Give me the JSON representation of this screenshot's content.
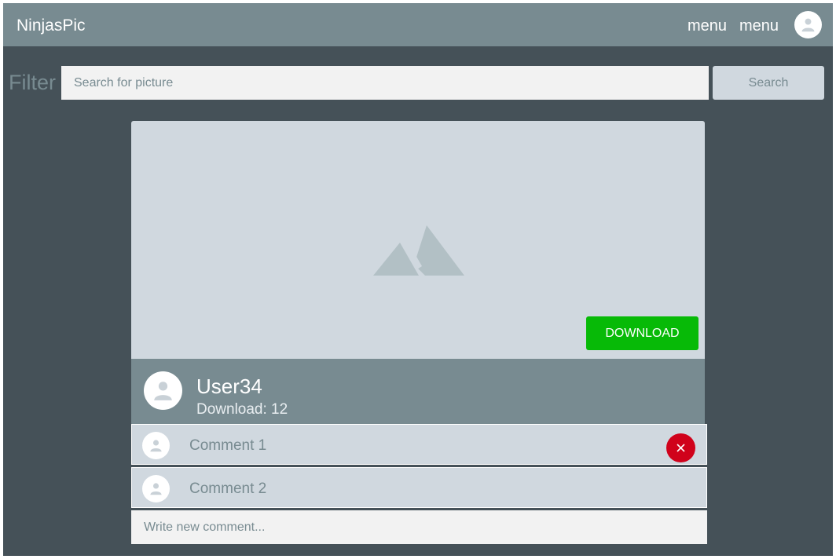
{
  "header": {
    "brand": "NinjasPic",
    "menus": [
      "menu",
      "menu"
    ],
    "avatar_icon": "user-icon"
  },
  "filter": {
    "label": "Filter",
    "placeholder": "Search for picture",
    "value": "",
    "button_label": "Search"
  },
  "picture": {
    "image_icon": "image-placeholder-icon",
    "download_label": "DOWNLOAD",
    "owner_name": "User34",
    "downloads_text": "Download: 12"
  },
  "comments": [
    {
      "text": "Comment 1",
      "avatar_icon": "user-icon",
      "deletable": true
    },
    {
      "text": "Comment 2",
      "avatar_icon": "user-icon",
      "deletable": false
    }
  ],
  "new_comment": {
    "placeholder": "Write new comment...",
    "value": ""
  },
  "colors": {
    "background": "#455158",
    "topbar": "#788b91",
    "panel": "#d0d8df",
    "input": "#f2f2f2",
    "download": "#07ba07",
    "delete": "#d0021b"
  }
}
